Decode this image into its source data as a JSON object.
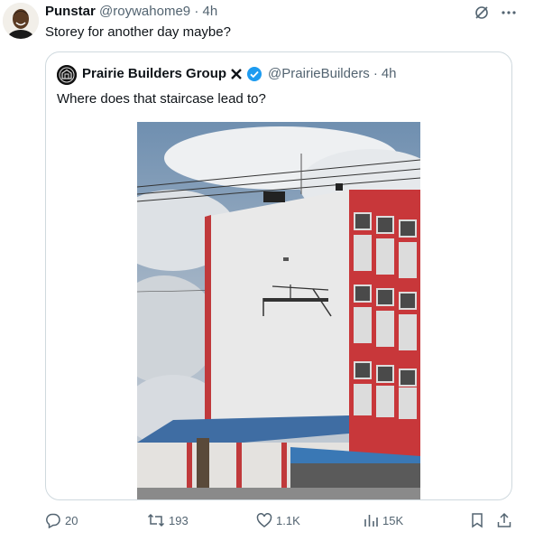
{
  "tweet": {
    "author_name": "Punstar",
    "author_handle": "@roywahome9",
    "separator": "·",
    "time": "4h",
    "text": "Storey for another day maybe?"
  },
  "quoted": {
    "author_name": "Prairie Builders Group",
    "author_handle": "@PrairieBuilders",
    "separator": "·",
    "time": "4h",
    "text": "Where does that staircase lead to?"
  },
  "actions": {
    "replies": "20",
    "reposts": "193",
    "likes": "1.1K",
    "views": "15K"
  },
  "icons": [
    "grok-icon",
    "more-icon",
    "x-affiliate-badge-icon",
    "verified-badge-icon",
    "reply-icon",
    "repost-icon",
    "like-icon",
    "views-icon",
    "bookmark-icon",
    "share-icon"
  ],
  "colors": {
    "text": "#0f1419",
    "secondary": "#536471",
    "border": "#cfd9de",
    "verified": "#1d9bf0"
  }
}
